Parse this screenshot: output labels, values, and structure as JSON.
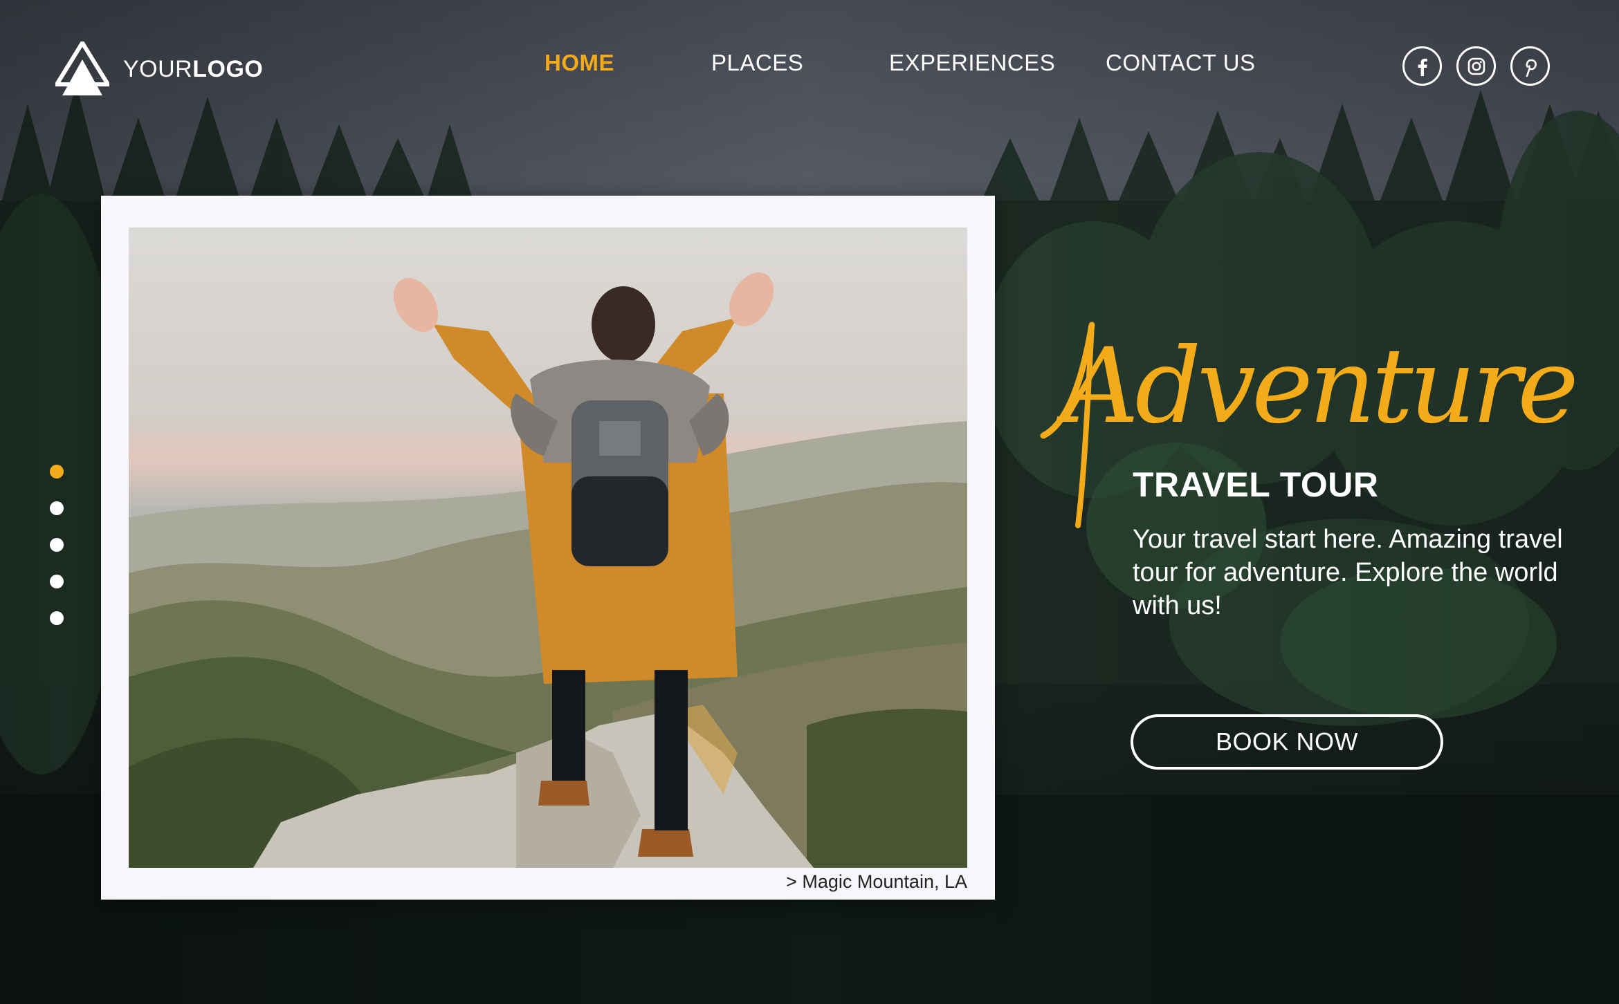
{
  "logo": {
    "prefix": "YOUR",
    "bold": "LOGO"
  },
  "nav": {
    "items": [
      {
        "label": "HOME",
        "active": true
      },
      {
        "label": "PLACES",
        "active": false
      },
      {
        "label": "EXPERIENCES",
        "active": false
      },
      {
        "label": "CONTACT US",
        "active": false
      }
    ]
  },
  "social": {
    "icons": [
      "facebook-icon",
      "instagram-icon",
      "pinterest-icon"
    ]
  },
  "carousel": {
    "slide_count": 5,
    "active_index": 0
  },
  "photo_card": {
    "caption": "> Magic Mountain, LA"
  },
  "hero": {
    "script_title": "Adventure",
    "title": "TRAVEL TOUR",
    "description": "Your travel start here. Amazing travel tour for adventure. Explore the world with us!",
    "cta_label": "BOOK NOW"
  },
  "colors": {
    "accent": "#f4ab19",
    "text": "#ffffff",
    "card_bg": "#f7f7fb"
  }
}
